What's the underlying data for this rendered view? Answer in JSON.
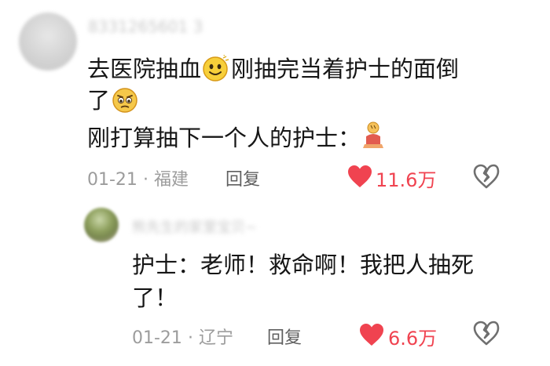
{
  "comment_1": {
    "username": "8331265601 3",
    "line_1_a": "去医院抽血",
    "line_1_b": "刚抽完当着护士的面倒",
    "line_2": "了",
    "line_3": "刚打算抽下一个人的护士：",
    "date": "01-21",
    "separator": "·",
    "location": "福建",
    "reply_label": "回复",
    "likes": "11.6万"
  },
  "reply_1": {
    "username": "熊先生的家里宝贝~",
    "line_1": "护士：老师！救命啊！我把人抽死",
    "line_2": "了！",
    "date": "01-21",
    "separator": "·",
    "location": "辽宁",
    "reply_label": "回复",
    "likes": "6.6万"
  },
  "colors": {
    "like_red": "#f04350",
    "meta_gray": "#9c9c9c",
    "text": "#161616"
  },
  "icons": [
    "smile-emoji-icon",
    "worried-emoji-icon",
    "kneeling-emoji-icon",
    "heart-filled-icon",
    "broken-heart-icon"
  ]
}
